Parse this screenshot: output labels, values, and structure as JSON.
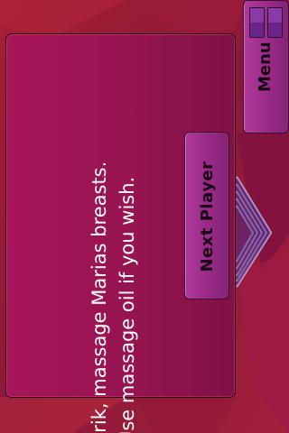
{
  "card": {
    "lines": [
      "Erik, massage Marias breasts.",
      "Use massage oil if  you wish."
    ]
  },
  "buttons": {
    "next_player_label": "Next Player",
    "menu_label": "Menu"
  },
  "icons": {
    "menu": "menu-bars-icon",
    "background": "diamond-pattern"
  },
  "colors": {
    "background": "#8f1a3a",
    "card": "#a8155a",
    "button": "#9a2a88",
    "button_text": "#1a0714",
    "prompt_text": "#ffffff"
  }
}
